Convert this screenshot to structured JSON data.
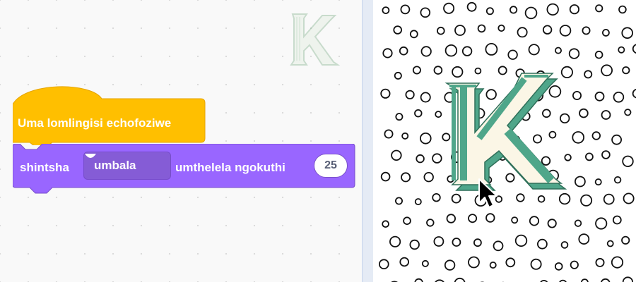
{
  "hat_block": {
    "label": "Uma lomlingisi echofoziwe",
    "color": "#ffbf00"
  },
  "looks_block": {
    "prefix": "shintsha",
    "dropdown_value": "umbala",
    "suffix": "umthelela ngokuthi",
    "number_value": "25",
    "color": "#9966ff"
  },
  "sprite": {
    "letter": "K",
    "color": "#4fa68a",
    "fill": "#fbf6e6"
  },
  "stage": {
    "background_pattern": "polka-dot-circles"
  },
  "icons": [
    "chevron-down-icon",
    "mouse-pointer-icon"
  ]
}
